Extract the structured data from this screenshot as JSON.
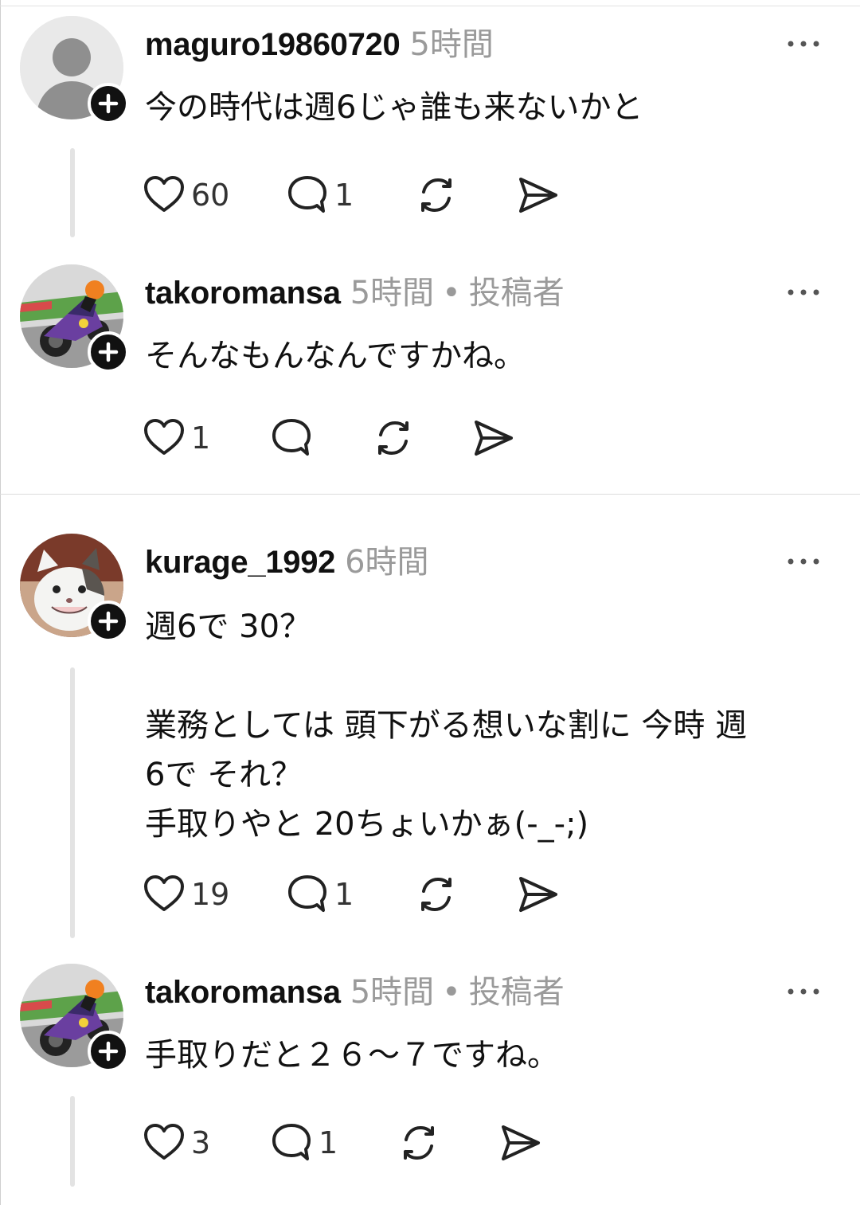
{
  "posts": [
    {
      "username": "maguro19860720",
      "time": "5時間",
      "author_tag": "",
      "body": "今の時代は週6じゃ誰も来ないかと",
      "likes": "60",
      "replies": "1",
      "avatar_icon": "default-person-avatar"
    },
    {
      "username": "takoromansa",
      "time": "5時間",
      "author_tag": "投稿者",
      "body": "そんなもんなんですかね。",
      "likes": "1",
      "replies": "",
      "avatar_icon": "motorcycle-rider-avatar"
    },
    {
      "username": "kurage_1992",
      "time": "6時間",
      "author_tag": "",
      "body": "週6で 30？\n\n業務としては 頭下がる想いな割に 今時 週\n6で それ？\n手取りやと 20ちょいかぁ(-_-;)",
      "likes": "19",
      "replies": "1",
      "avatar_icon": "cat-avatar"
    },
    {
      "username": "takoromansa",
      "time": "5時間",
      "author_tag": "投稿者",
      "body": "手取りだと２６～７ですね。",
      "likes": "3",
      "replies": "1",
      "avatar_icon": "motorcycle-rider-avatar"
    }
  ],
  "icons": {
    "like": "heart-icon",
    "reply": "comment-bubble-icon",
    "repost": "repost-icon",
    "share": "send-icon",
    "more": "more-options-icon",
    "follow": "plus-icon"
  },
  "colors": {
    "text": "#111111",
    "muted": "#9a9a9a",
    "thread_line": "#e3e3e3"
  }
}
